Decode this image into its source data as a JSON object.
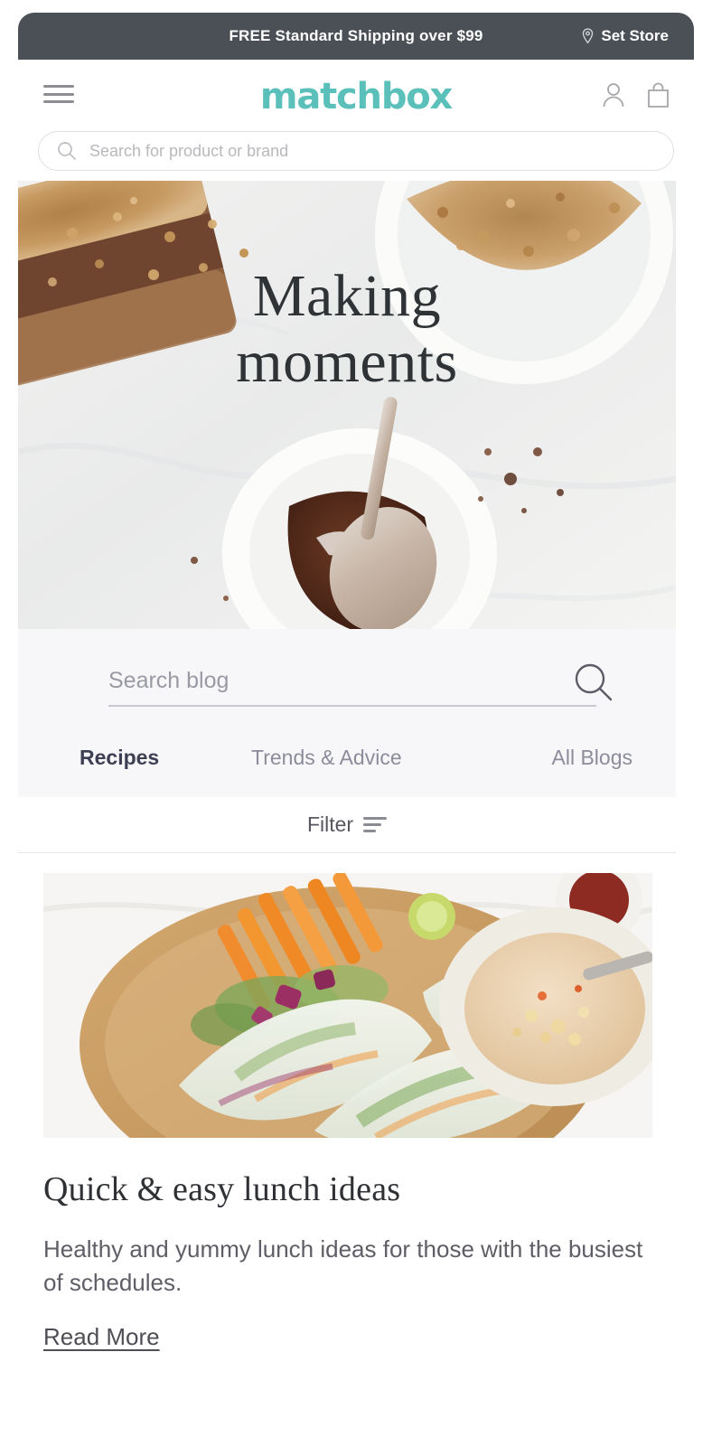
{
  "promo": {
    "message": "FREE Standard Shipping over $99",
    "set_store_label": "Set Store",
    "pin_icon": "location-pin-icon",
    "bg_color": "#4b5057"
  },
  "header": {
    "menu_icon": "hamburger-menu-icon",
    "logo_text": "matchbox",
    "logo_color": "#5bbfba",
    "account_icon": "user-account-icon",
    "bag_icon": "shopping-bag-icon"
  },
  "search": {
    "placeholder": "Search for product or brand",
    "icon": "search-icon",
    "value": ""
  },
  "hero": {
    "title_line1": "Making",
    "title_line2": "moments",
    "alt": "Lamington cake and bowl of cocoa on marble"
  },
  "blog_search": {
    "placeholder": "Search blog",
    "icon": "search-icon",
    "value": ""
  },
  "tabs": [
    {
      "label": "Recipes",
      "active": true
    },
    {
      "label": "Trends & Advice",
      "active": false
    },
    {
      "label": "All Blogs",
      "active": false
    }
  ],
  "filter": {
    "label": "Filter",
    "icon": "filter-lines-icon"
  },
  "article": {
    "title": "Quick & easy lunch ideas",
    "description": "Healthy and yummy lunch ideas for those with the busiest of schedules.",
    "read_more_label": "Read More",
    "image_alt": "Rice paper rolls with peanut dipping sauce"
  }
}
